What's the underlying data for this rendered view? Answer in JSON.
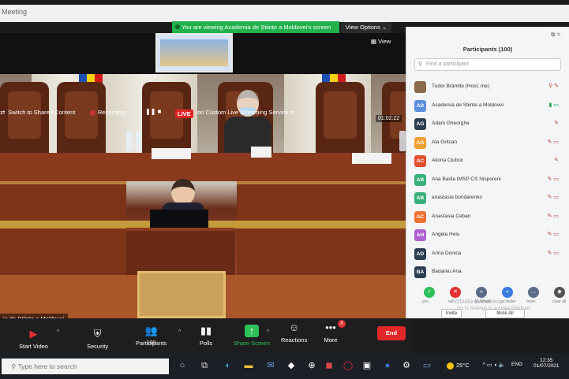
{
  "window": {
    "title": "Meeting"
  },
  "share_banner": "You are viewing Academia de Științe a Moldovei's screen",
  "view_options": "View Options ⌄",
  "view_label": "View",
  "overlay": {
    "switch_shared": "Switch to Shared Content",
    "recording": "Recording...",
    "live": "LIVE",
    "live_service": "on Custom Live Streaming Service",
    "timer": "01:02:22"
  },
  "video_name": "ia de Științe a Moldovei",
  "toolbar": {
    "start_video": "Start Video",
    "security": "Security",
    "participants": "Participants",
    "participants_count": "100",
    "polls": "Polls",
    "share_screen": "Share Screen",
    "reactions": "Reactions",
    "more": "More",
    "more_badge": "8",
    "end": "End"
  },
  "panel": {
    "title": "Participants (100)",
    "find_placeholder": "Find a participant",
    "participants": [
      {
        "initials": "",
        "name": "Tudor Bramite (Host, me)",
        "color": "#8a6b4a",
        "icons": "⚲ ✎"
      },
      {
        "initials": "AD",
        "name": "Academia de Stiinte a Moldovei",
        "color": "#5b8de0",
        "icons": "▮ ▭",
        "icons_green": true
      },
      {
        "initials": "AG",
        "name": "Adam Gheorghe",
        "color": "#2c3e50",
        "icons": "✎"
      },
      {
        "initials": "AG",
        "name": "Ala Gritcan",
        "color": "#f0a030",
        "icons": "✎ ▭"
      },
      {
        "initials": "AC",
        "name": "Aliona Ciuboc",
        "color": "#e05030",
        "icons": "✎"
      },
      {
        "initials": "AB",
        "name": "Ana Barila IMSP CS Nisporeni",
        "color": "#38b07a",
        "icons": "✎ ▭"
      },
      {
        "initials": "AB",
        "name": "anastasia bondarenko",
        "color": "#38b07a",
        "icons": "✎ ▭"
      },
      {
        "initials": "AC",
        "name": "Anastasia Ceban",
        "color": "#f07030",
        "icons": "✎ ▭"
      },
      {
        "initials": "AH",
        "name": "Angela Heiu",
        "color": "#b060d0",
        "icons": "✎ ▭"
      },
      {
        "initials": "AD",
        "name": "Anna Donica",
        "color": "#2c3e50",
        "icons": "✎ ▭"
      },
      {
        "initials": "BA",
        "name": "Badareu Ana",
        "color": "#2c3e50",
        "icons": ""
      }
    ],
    "reactions": [
      {
        "sym": "✓",
        "color": "#2dc15a",
        "label": "yes"
      },
      {
        "sym": "✕",
        "color": "#e03030",
        "label": "no"
      },
      {
        "sym": "«",
        "color": "#5b6b8a",
        "label": "go slower"
      },
      {
        "sym": "»",
        "color": "#3a7be0",
        "label": "go faster"
      },
      {
        "sym": "…",
        "color": "#5b6b8a",
        "label": "more"
      },
      {
        "sym": "◆",
        "color": "#555",
        "label": "clear all"
      }
    ],
    "activate_title": "Activate Windows",
    "activate_sub": "Go to Settings to activate Windows.",
    "invite": "Invite",
    "mute_all": "Mute All"
  },
  "taskbar": {
    "search_placeholder": "Type here to search",
    "temperature": "25°C",
    "lang": "ENG",
    "time": "12:35",
    "date": "01/07/2021"
  }
}
